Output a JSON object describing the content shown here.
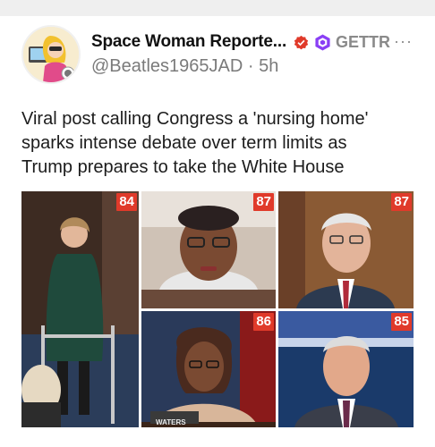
{
  "post": {
    "display_name": "Space Woman Reporte...",
    "platform": "GETTR",
    "handle": "@Beatles1965JAD",
    "separator": "·",
    "time": "5h",
    "more": "···",
    "text_lines": [
      "Viral post calling Congress a 'nursing home'",
      "sparks intense debate over term limits as",
      "Trump prepares to take the White House"
    ]
  },
  "images": [
    {
      "badge": "84"
    },
    {
      "badge": "87"
    },
    {
      "badge": "87"
    },
    {
      "badge": "86",
      "nameplate": "WATERS"
    },
    {
      "badge": "85"
    }
  ],
  "colors": {
    "badge": "#e03a2a",
    "verified": "#e03a2a",
    "gettr": "#8a3ff5",
    "handle": "#7a7a7a"
  },
  "icons": [
    "verified-badge-icon",
    "gettr-logo-icon",
    "more-options-icon"
  ]
}
